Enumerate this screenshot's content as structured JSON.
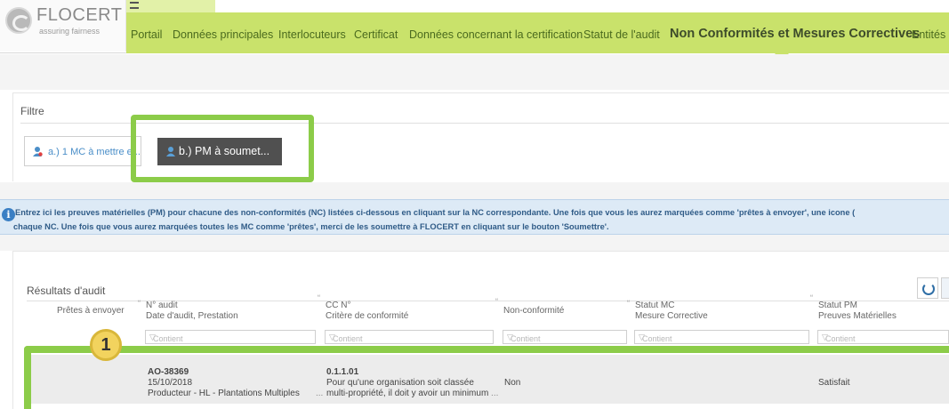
{
  "header": {
    "logo_name": "FLOCERT",
    "logo_tagline": "assuring fairness",
    "nav": [
      {
        "label": "Portail",
        "active": false
      },
      {
        "label": "Données principales",
        "active": false
      },
      {
        "label": "Interlocuteurs",
        "active": false
      },
      {
        "label": "Certificat",
        "active": false
      },
      {
        "label": "Données concernant la certification",
        "active": false
      },
      {
        "label": "Statut de l'audit",
        "active": false
      },
      {
        "label": "Non Conformités et Mesures Correctives",
        "active": true
      },
      {
        "label": "Entités a",
        "active": false
      }
    ]
  },
  "filter": {
    "title": "Filtre",
    "buttons": [
      {
        "label": "a.) 1 MC à mettre e...",
        "selected": false
      },
      {
        "label": "b.) PM à soumet...",
        "selected": true
      }
    ]
  },
  "info": {
    "line1": "Entrez ici les preuves matérielles (PM) pour chacune des non-conformités (NC) listées ci-dessous en cliquant sur la NC correspondante. Une fois que vous les aurez marquées comme 'prêtes à envoyer', une icone (",
    "line2": "chaque NC. Une fois que vous aurez marquées toutes les MC comme 'prêtes', merci de les soumettre à FLOCERT en cliquant sur le bouton 'Soumettre'."
  },
  "results": {
    "title": "Résultats d'audit",
    "columns": [
      {
        "line1": "Prêtes à envoyer",
        "line2": ""
      },
      {
        "line1": "N° audit",
        "line2": "Date d'audit, Prestation"
      },
      {
        "line1": "CC N°",
        "line2": "Critère de conformité"
      },
      {
        "line1": "Non-conformité",
        "line2": ""
      },
      {
        "line1": "Statut MC",
        "line2": "Mesure Corrective"
      },
      {
        "line1": "Statut PM",
        "line2": "Preuves Matérielles"
      }
    ],
    "filter_placeholder": "Contient",
    "rows": [
      {
        "audit_no": "AO-38369",
        "date": "15/10/2018",
        "prestation": "Producteur - HL - Plantations Multiples",
        "cc_no": "0.1.1.01",
        "criterion_l1": "Pour qu'une organisation soit classée",
        "criterion_l2": "multi-propriété, il doit y avoir un minimum",
        "non_conformite": "Non",
        "statut_pm": "Satisfait"
      }
    ]
  },
  "annotation": {
    "badge": "1"
  },
  "colors": {
    "nav_bg": "#c9e26b",
    "highlight": "#8ccc49",
    "info_bg": "#ddeaf6"
  }
}
